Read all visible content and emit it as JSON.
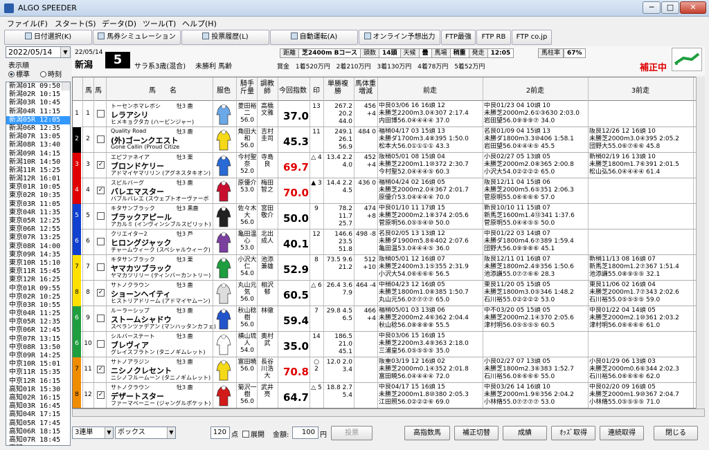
{
  "window": {
    "title": "ALGO SPEEDER"
  },
  "menu": [
    "ファイル(F)",
    "スタート(S)",
    "データ(D)",
    "ツール(T)",
    "ヘルプ(H)"
  ],
  "toolbar": {
    "date_select": "日付選択(K)",
    "betting_sim": "馬券シミュレーション(B)",
    "vote_history": "投票履歴(L)",
    "auto_run": "自動運転(A)",
    "online_forecast": "オンライン予想出力",
    "ftp_best": "FTP最強",
    "ftp_rb": "FTP RB",
    "ftp_co": "FTP co.jp"
  },
  "left": {
    "date": "2022/05/14",
    "sort_label": "表示順",
    "radio_standard": "標準",
    "radio_time": "時刻",
    "races": [
      "新潟01R 09:50",
      "新潟02R 10:15",
      "新潟03R 10:45",
      "新潟04R 11:15",
      "新潟05R 12:05",
      "新潟06R 12:35",
      "新潟07R 13:05",
      "新潟08R 13:40",
      "新潟09R 14:15",
      "新潟10R 14:50",
      "新潟11R 15:25",
      "新潟12R 16:01",
      "東京01R 10:05",
      "東京02R 10:35",
      "東京03R 11:05",
      "東京04R 11:35",
      "東京05R 12:25",
      "東京06R 12:55",
      "東京07R 13:25",
      "東京08R 14:00",
      "東京09R 14:35",
      "東京10R 15:10",
      "東京11R 15:45",
      "東京12R 16:25",
      "中京01R 09:55",
      "中京02R 10:25",
      "中京03R 10:55",
      "中京04R 11:25",
      "中京05R 12:35",
      "中京06R 12:45",
      "中京07R 13:15",
      "中京08R 13:50",
      "中京09R 14:25",
      "中京10R 15:01",
      "中京11R 15:35",
      "中京12R 16:15",
      "高知01R 15:30",
      "高知02R 16:15",
      "高知03R 16:45",
      "高知04R 17:15",
      "高知05R 17:45",
      "高知06R 18:15",
      "高知07R 18:45",
      "高知08R 19:20"
    ],
    "selected_race": "新潟05R 12:05"
  },
  "race": {
    "date": "22/05/14",
    "track": "新潟",
    "number": "5",
    "class": "サラ系3歳(混合)",
    "name": "未勝利 馬齢",
    "distance_label": "距離",
    "distance": "芝2400m Bコース",
    "heads_label": "頭数",
    "heads": "14頭",
    "weather_label": "天候",
    "weather": "曇",
    "going_label": "馬場",
    "going": "稍重",
    "post_label": "発走",
    "post": "12:05",
    "rate_label": "馬柱率",
    "rate": "67%",
    "prize": "賞金 1着520万円 2着210万円 3着130万円 4着78万円 5着52万円",
    "correction": "補正中"
  },
  "columns": {
    "waku": "馬",
    "umaban": "馬",
    "name": "馬　　名",
    "silk": "服色",
    "jockey": "騎手斤量",
    "trainer": "調教師",
    "index": "今回指数",
    "mark": "印",
    "odds": "単勝複勝",
    "weight": "馬体重増減",
    "prev1": "前走",
    "prev2": "2前走",
    "prev3": "3前走"
  },
  "horses": [
    {
      "waku": "1",
      "num": "1",
      "color": "#ffffff",
      "sire": "トーセンホマレボシ",
      "name": "レラアシリ",
      "dam": "ヒメキョクタカ (ハービンジャー)",
      "sexage": "牡3 鹿",
      "silk": "#6aa8e8",
      "jockey": "菱田裕二56.0",
      "trainer": "高橋文雅",
      "index": "37.0",
      "mark": "13",
      "odds": "267.2 20.2 44.0",
      "weight": "456 +4",
      "p1a": "中良03/06 16 16頭 12",
      "p1b": "未勝芝2200m3.0④307 2:17.4",
      "p1c": "内田博56.0④④④④ 37.0",
      "p2a": "中良01/23 04 10頭 10",
      "p2b": "未勝芝2000m2.6①③630 2:03.0",
      "p2c": "岩田望56.0⑨⑨⑨⑦ 34.0",
      "p3a": "",
      "p3b": "",
      "p3c": ""
    },
    {
      "waku": "2",
      "num": "2",
      "color": "#000000",
      "sire": "Quality Road",
      "name": "(外)ゴーンクエスト",
      "dam": "Gone Callin (Proud Citize",
      "sexage": "牡3 鹿",
      "silk": "#f5d816",
      "jockey": "角田大和56.0",
      "trainer": "吉村圭司",
      "index": "45.3",
      "mark": "11",
      "odds": "249.1 26.1 56.9",
      "weight": "484 0",
      "p1a": "福稍04/17 03 15頭 13",
      "p1b": "未勝ダ1700m3.4⑧395 1:50.0",
      "p1c": "松本大56.0①①①① 43.3",
      "p2a": "名良01/09 04 15頭 13",
      "p2b": "未勝ダ1800m3.3⑩406 1:58.1",
      "p2c": "岩田望56.0④④④⑤ 45.5",
      "p3a": "阪良12/26 12 16頭 10",
      "p3b": "未勝芝2000m3.0④395 2:05.2",
      "p3c": "団野大55.0⑥⑦⑥⑥ 45.8"
    },
    {
      "waku": "3",
      "num": "3",
      "color": "#e00000",
      "sire": "エピファネイア",
      "name": "ブロンドケリー",
      "dam": "アドマイヤマリリン (アグネスタキオン)",
      "sexage": "牡3 栗",
      "silk": "#2a6ad6",
      "jockey": "今村聖奈52.0",
      "trainer": "寺島良",
      "index": "69.7",
      "mark": "△ 4",
      "odds": "13.4 2.2 4.0",
      "weight": "452 +4",
      "p1a": "阪稍05/01 08 15頭 04",
      "p1b": "未勝芝2200m1.1⑩372 2:30.7",
      "p1c": "今村聖52.0④④④⑤ 60.3",
      "p2a": "小良02/27 05 13頭 05",
      "p2b": "未勝芝2000m2.0⑧365 2:00.8",
      "p2c": "小沢大54.0②②②② 65.0",
      "p3a": "新稍02/19 16 13頭 10",
      "p3b": "未勝芝1800m1.7⑥391 2:01.5",
      "p3c": "松山弘56.0④④④④ 61.4"
    },
    {
      "waku": "4",
      "num": "4",
      "color": "#e00000",
      "sire": "スピルバーグ",
      "name": "バレエマスター",
      "dam": "バブルバレエ (スウェプトオーヴァーボ",
      "sexage": "牡3 鹿",
      "silk": "#c8102e",
      "jockey": "原優介53.0",
      "trainer": "梅田智之",
      "index": "70.0",
      "mark": "▲ 3",
      "odds": "14.4 2.2 4.5",
      "weight": "436 0",
      "p1a": "福稍04/24 02 16頭 05",
      "p1b": "未勝芝2000m2.0④367 2:01.7",
      "p1c": "原優介53.0④④④④ 70.0",
      "p2a": "阪良12/11 04 15頭 06",
      "p2b": "未勝芝2000m5.6⑤351 2:06.3",
      "p2c": "菅原明55.0⑥⑥⑥⑥ 57.0",
      "p3a": "",
      "p3b": "",
      "p3c": ""
    },
    {
      "waku": "5",
      "num": "5",
      "color": "#1040d0",
      "sire": "キタサンブラック",
      "name": "ブラックアピール",
      "dam": "アカルミ (インヴィンシブルスピリット)",
      "sexage": "牡3 黒鹿",
      "silk": "#222222",
      "jockey": "佐々木大56.0",
      "trainer": "宮田敬介",
      "index": "50.0",
      "mark": "9",
      "odds": "78.2 11.7 25.7",
      "weight": "474 +8",
      "p1a": "中良01/10 11 17頭 15",
      "p1b": "未勝芝2000m2.1⑧374 2:05.6",
      "p1c": "菅原明56.0⑤⑤④⑩ 50.0",
      "p2a": "新良10/10 11 15頭 07",
      "p2b": "新馬芝1600m1.4⑬341 1:37.6",
      "p2c": "菅原明55.0④④⑤⑤ 50.0",
      "p3a": "",
      "p3b": "",
      "p3c": ""
    },
    {
      "waku": "6",
      "num": "6",
      "color": "#1040d0",
      "sire": "クリエイター2",
      "name": "ヒロングジャック",
      "dam": "チャームウィーク (スペシャルウィーク)",
      "sexage": "牡3 芦",
      "silk": "#7b3fa0",
      "jockey": "亀田温心53.0",
      "trainer": "北出成人",
      "index": "40.1",
      "mark": "12",
      "odds": "146.6 23.5 51.8",
      "weight": "498 -8",
      "p1a": "名良02/05 13 13頭 12",
      "p1b": "未勝ダ1900m5.8⑥402 2:07.6",
      "p1c": "亀田温53.0④④④⑤ 36.0",
      "p2a": "中良01/22 03 14頭 07",
      "p2b": "未勝ダ1800m4.6⑦389 1:59.4",
      "p2c": "団野大56.0⑨⑨⑧⑥ 45.1",
      "p3a": "",
      "p3b": "",
      "p3c": ""
    },
    {
      "waku": "7",
      "num": "7",
      "color": "#ffe000",
      "sire": "キタサンブラック",
      "name": "ヤマカツブラック",
      "dam": "ヤマカツリリー (ティンバーカントリー)",
      "sexage": "牡3 栗",
      "silk": "#1e9e3e",
      "jockey": "小沢大仁54.0",
      "trainer": "池添兼雄",
      "index": "52.9",
      "mark": "8",
      "odds": "73.5 9.6 21.2",
      "weight": "512 +10",
      "p1a": "阪稍05/01 12 16頭 07",
      "p1b": "未勝芝2400m3.1⑤355 2:31.9",
      "p1c": "小沢大54.0⑥⑥⑥⑥ 56.5",
      "p2a": "阪良12/11 01 16頭 07",
      "p2b": "未勝芝1800m2.4⑨356 1:50.6",
      "p2c": "池添謙55.0⑦⑦⑥⑥ 28.3",
      "p3a": "新稍11/13 08 16頭 07",
      "p3b": "新馬芝1800m1.2⑦367 1:51.4",
      "p3c": "池添謙55.0⑧⑨⑤⑤ 32.1"
    },
    {
      "waku": "8",
      "num": "8",
      "color": "#ffe000",
      "sire": "サトノクラウン",
      "name": "ショーンヘイティ",
      "dam": "ヒストリアドリーム (アドマイヤムーン)",
      "sexage": "牡3 鹿",
      "silk": "#dddddd",
      "jockey": "丸山元気56.0",
      "trainer": "相沢郁",
      "index": "60.5",
      "mark": "△ 6",
      "odds": "26.4 3.6 7.9",
      "weight": "464 -4",
      "p1a": "中稍04/23 12 16頭 05",
      "p1b": "未勝芝1800m1.0⑧385 1:50.7",
      "p1c": "丸山元56.0⑦⑦⑦⑦ 65.0",
      "p2a": "東良11/20 05 15頭 05",
      "p2b": "未勝芝1800m3.0⑤346 1:48.2",
      "p2c": "石川裕55.0②②②② 53.0",
      "p3a": "東良11/06 02 16頭 04",
      "p3b": "未勝芝2000m1.7⑦343 2:02.6",
      "p3c": "石川裕55.0⑤⑤⑤⑤ 59.0"
    },
    {
      "waku": "6",
      "num": "9",
      "color": "#1e9e3e",
      "sire": "ルーラーシップ",
      "name": "ストームシャドウ",
      "dam": "スペランツァデアン (マンハッタンカフェ)",
      "sexage": "牡3 鹿",
      "silk": "#2255cc",
      "jockey": "秋山稔樹56.0",
      "trainer": "林徹",
      "index": "59.4",
      "mark": "7",
      "odds": "29.8 4.5 6.5",
      "weight": "466 +4",
      "p1a": "福稍05/01 03 13頭 06",
      "p1b": "未勝芝2000m2.4⑥362 2:04.4",
      "p1c": "秋山稔56.0⑧⑧⑧⑧ 55.5",
      "p2a": "中不03/20 05 15頭 05",
      "p2b": "未勝芝2000m2.1④370 2:05.6",
      "p2c": "津村明56.0⑤⑤⑤⑤ 60.5",
      "p3a": "中良01/22 04 14頭 05",
      "p3b": "未勝芝2000m2.1⑩361 2:03.2",
      "p3c": "津村明56.0⑥⑥⑥⑥ 61.0"
    },
    {
      "waku": "6",
      "num": "10",
      "color": "#1e9e3e",
      "sire": "シルバーステート",
      "name": "ブレヴィア",
      "dam": "グレイスフラトン (タニノギムレット)",
      "sexage": "牡3 鹿",
      "silk": "#ffffff",
      "jockey": "横山琉人54.0",
      "trainer": "奥村武",
      "index": "35.0",
      "mark": "14",
      "odds": "186.5 21.0 45.1",
      "weight": "",
      "p1a": "中良03/06 15 16頭 15",
      "p1b": "未勝芝2200m3.4⑨363 2:18.0",
      "p1c": "三浦皇56.0⑤⑤⑤⑤ 35.0",
      "p2a": "",
      "p2b": "",
      "p2c": "",
      "p3a": "",
      "p3b": "",
      "p3c": ""
    },
    {
      "waku": "7",
      "num": "11",
      "color": "#f08c00",
      "sire": "サトノアラジン",
      "name": "ニシノクレセント",
      "dam": "ニシノフルームーン (タニノギムレット)",
      "sexage": "牡3 鹿",
      "silk": "#f5d816",
      "jockey": "富田暁56.0",
      "trainer": "長谷川浩大",
      "index": "70.8",
      "mark": "○ 2",
      "odds": "12.0 2.0 3.4",
      "weight": "",
      "p1a": "阪重03/19 12 16頭 02",
      "p1b": "未勝芝2000m0.1④352 2:01.8",
      "p1c": "富田暁56.0④④④④ 72.0",
      "p2a": "小良02/27 07 13頭 05",
      "p2b": "未勝芝1800m2.3⑥383 1:52.7",
      "p2c": "石川裕56.0⑥⑥⑥⑥ 55.0",
      "p3a": "小良01/29 06 13頭 03",
      "p3b": "未勝芝2000m0.6⑥344 2:02.3",
      "p3c": "石川裕56.0⑥⑥⑥⑥ 62.0"
    },
    {
      "waku": "8",
      "num": "12",
      "color": "#f08c00",
      "sire": "サトノクラウン",
      "name": "デザートスター",
      "dam": "ファーマベーニー (ジャングルポケット)",
      "sexage": "牡3 鹿",
      "silk": "#d21a1a",
      "jockey": "菊沢一樹56.0",
      "trainer": "武井亮",
      "index": "64.7",
      "mark": "△ 5",
      "odds": "18.8 2.7 5.4",
      "weight": "",
      "p1a": "中良04/17 15 16頭 15",
      "p1b": "未勝芝2000m1.8⑩380 2:05.3",
      "p1c": "江田照56.0②②②⑥ 69.0",
      "p2a": "中良03/26 14 16頭 10",
      "p2b": "未勝芝2000m1.9⑥356 2:04.2",
      "p2c": "小林脩55.0⑦⑦⑦⑦ 53.0",
      "p3a": "中良02/20 09 16頭 05",
      "p3b": "未勝芝2000m1.9⑩367 2:04.7",
      "p3c": "小林脩55.0⑤⑤⑤⑤ 71.0"
    }
  ],
  "bottom": {
    "bet_type": "3連単",
    "bet_method": "ボックス",
    "points": "120",
    "points_unit": "点",
    "expand": "展開",
    "amount_label": "金額:",
    "amount": "100",
    "amount_unit": "円",
    "vote": "投票",
    "hc_count": "高指数馬",
    "correction_cut": "補正切替",
    "results": "成績",
    "odds_get": "ｵｯｽﾞ取得",
    "continuous_get": "連続取得",
    "close": "閉じる"
  }
}
